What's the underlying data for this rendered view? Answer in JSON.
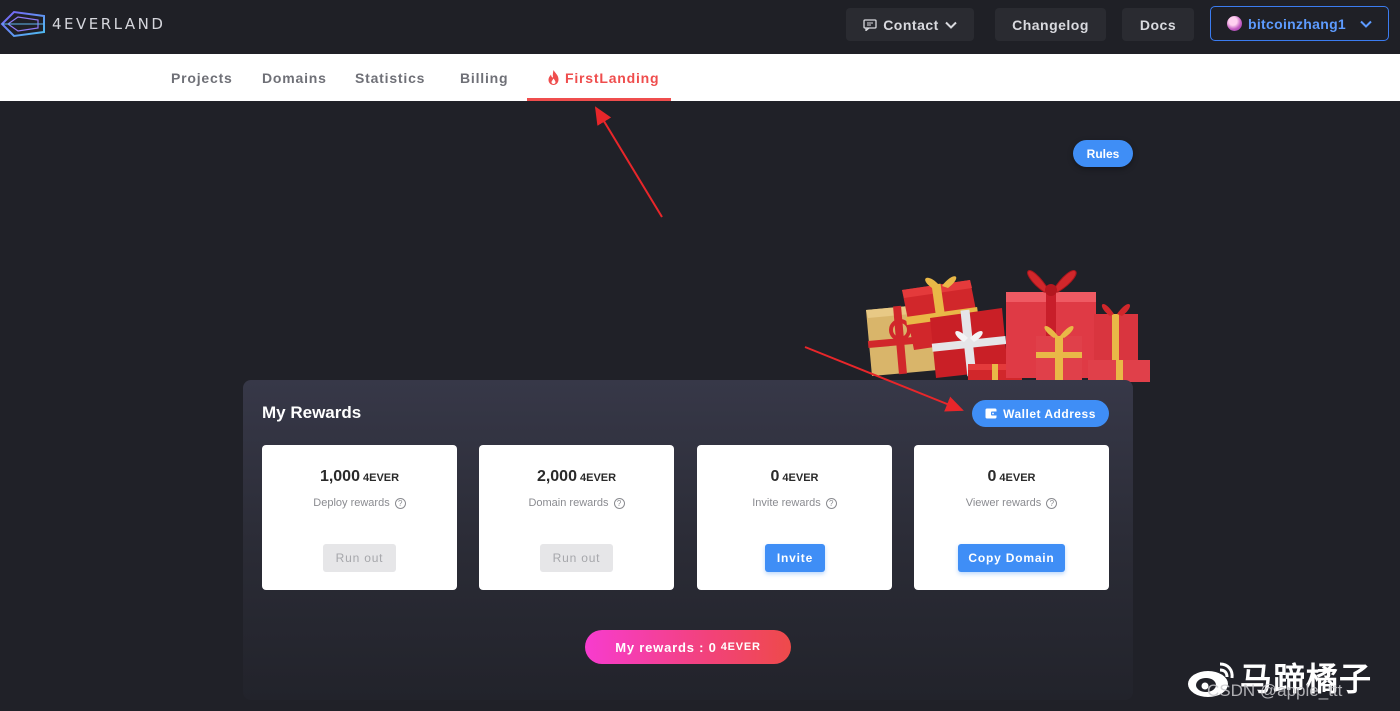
{
  "header": {
    "logo_text": "4EVERLAND",
    "contact_label": "Contact",
    "changelog_label": "Changelog",
    "docs_label": "Docs",
    "username": "bitcoinzhang1"
  },
  "nav": {
    "tabs": [
      {
        "label": "Projects"
      },
      {
        "label": "Domains"
      },
      {
        "label": "Statistics"
      },
      {
        "label": "Billing"
      },
      {
        "label": "FirstLanding",
        "active": true
      }
    ]
  },
  "rules_label": "Rules",
  "rewards": {
    "title": "My Rewards",
    "wallet_label": "Wallet Address",
    "cards": [
      {
        "value": "1,000",
        "unit": "4EVER",
        "label": "Deploy rewards",
        "button": "Run out",
        "button_enabled": false
      },
      {
        "value": "2,000",
        "unit": "4EVER",
        "label": "Domain rewards",
        "button": "Run out",
        "button_enabled": false
      },
      {
        "value": "0",
        "unit": "4EVER",
        "label": "Invite rewards",
        "button": "Invite",
        "button_enabled": true
      },
      {
        "value": "0",
        "unit": "4EVER",
        "label": "Viewer rewards",
        "button": "Copy Domain",
        "button_enabled": true
      }
    ],
    "total_label": "My rewards : 0",
    "total_unit": "4EVER"
  },
  "watermark": {
    "brand": "马蹄橘子",
    "csdn": "CSDN @apple_ttt"
  },
  "colors": {
    "background": "#202128",
    "accent_blue": "#3f8ef6",
    "accent_red": "#ef4d4d",
    "total_gradient_start": "#f73ccf",
    "total_gradient_end": "#ee4a4a"
  },
  "icons": {
    "contact": "message-icon",
    "wallet": "wallet-icon",
    "active_tab": "flame-icon",
    "help": "question-circle-icon"
  }
}
